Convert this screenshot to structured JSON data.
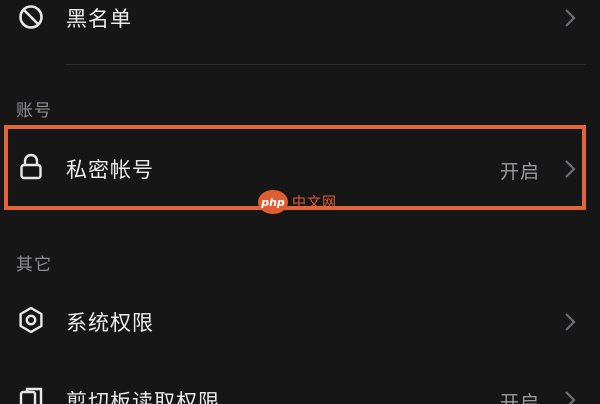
{
  "rows": {
    "blacklist": {
      "label": "黑名单",
      "icon": "block-icon"
    },
    "private_account": {
      "label": "私密帐号",
      "value": "开启",
      "icon": "lock-icon"
    },
    "system_permissions": {
      "label": "系统权限",
      "icon": "settings-hexagon-icon"
    },
    "clipboard_permission": {
      "label": "剪切板读取权限",
      "value": "开启",
      "icon": "clipboard-icon"
    }
  },
  "sections": {
    "account": "账号",
    "other": "其它"
  },
  "colors": {
    "background": "#161617",
    "highlight": "#e0663a",
    "watermark": "#e05d33"
  },
  "watermark": {
    "badge": "php",
    "text": "中文网"
  }
}
